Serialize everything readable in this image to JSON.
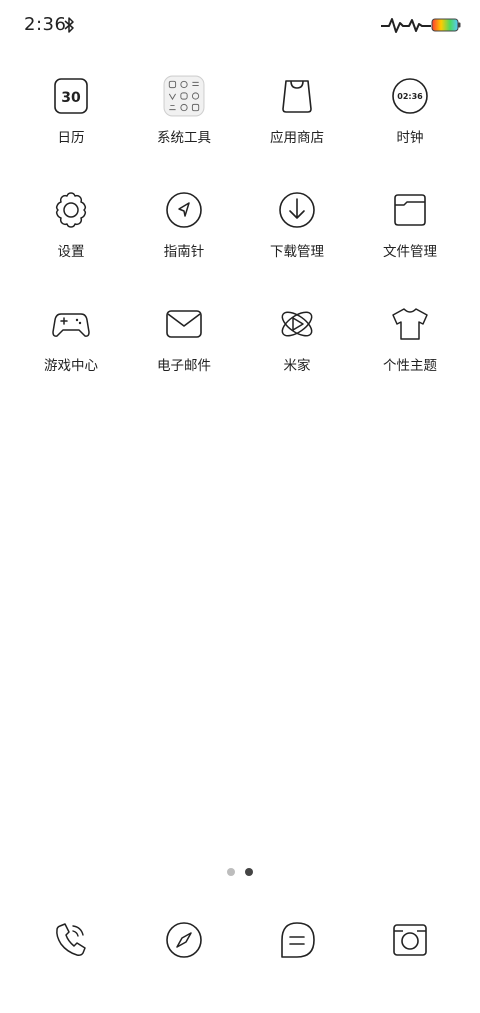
{
  "status_bar": {
    "time": "2:36",
    "bluetooth_icon": "bluetooth-icon",
    "signal_icon": "heartbeat-signal-icon",
    "battery_icon": "battery-icon",
    "battery_colors": [
      "#ff3b30",
      "#ffcc00",
      "#4cd964",
      "#5ac8fa"
    ]
  },
  "apps": [
    {
      "label": "日历",
      "icon": "calendar-icon",
      "icon_text": "30"
    },
    {
      "label": "系统工具",
      "icon": "system-tools-folder-icon"
    },
    {
      "label": "应用商店",
      "icon": "app-store-bag-icon"
    },
    {
      "label": "时钟",
      "icon": "clock-icon",
      "icon_text": "02:36"
    },
    {
      "label": "设置",
      "icon": "gear-icon"
    },
    {
      "label": "指南针",
      "icon": "compass-icon"
    },
    {
      "label": "下载管理",
      "icon": "download-icon"
    },
    {
      "label": "文件管理",
      "icon": "folder-icon"
    },
    {
      "label": "游戏中心",
      "icon": "gamepad-icon"
    },
    {
      "label": "电子邮件",
      "icon": "mail-icon"
    },
    {
      "label": "米家",
      "icon": "mijia-icon"
    },
    {
      "label": "个性主题",
      "icon": "tshirt-theme-icon"
    }
  ],
  "page_indicator": {
    "pages": 2,
    "current": 2
  },
  "dock": [
    {
      "icon": "phone-icon"
    },
    {
      "icon": "browser-compass-icon"
    },
    {
      "icon": "messages-icon"
    },
    {
      "icon": "camera-icon"
    }
  ]
}
